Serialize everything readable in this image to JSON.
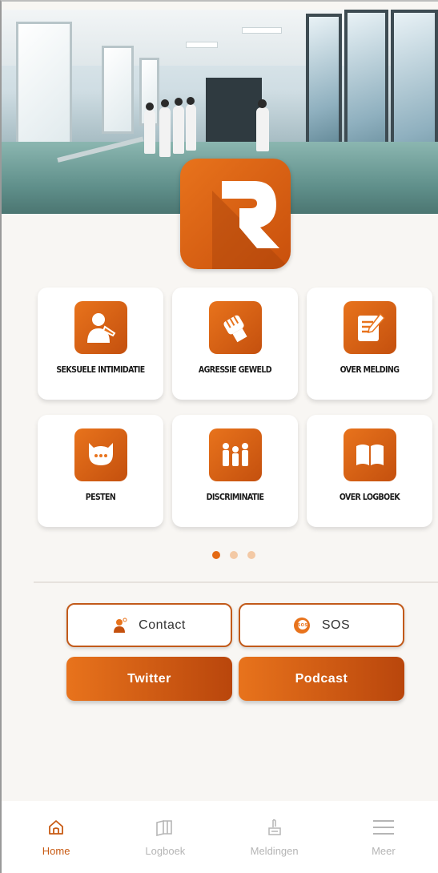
{
  "brand": {
    "accent": "#e46a14",
    "accent_dark": "#c4500e"
  },
  "logo": {
    "letter": "R"
  },
  "tiles": [
    {
      "label": "SEKSUELE INTIMIDATIE",
      "icon": "harassment-icon"
    },
    {
      "label": "AGRESSIE GEWELD",
      "icon": "fist-icon"
    },
    {
      "label": "OVER MELDING",
      "icon": "note-edit-icon"
    },
    {
      "label": "PESTEN",
      "icon": "chat-bubble-icon"
    },
    {
      "label": "DISCRIMINATIE",
      "icon": "people-group-icon"
    },
    {
      "label": "OVER LOGBOEK",
      "icon": "open-book-icon"
    }
  ],
  "pagination": {
    "pages": 3,
    "current": 1
  },
  "actions": {
    "contact": "Contact",
    "sos": "SOS",
    "twitter": "Twitter",
    "podcast": "Podcast"
  },
  "nav": {
    "home": "Home",
    "logboek": "Logboek",
    "meldingen": "Meldingen",
    "meer": "Meer"
  }
}
